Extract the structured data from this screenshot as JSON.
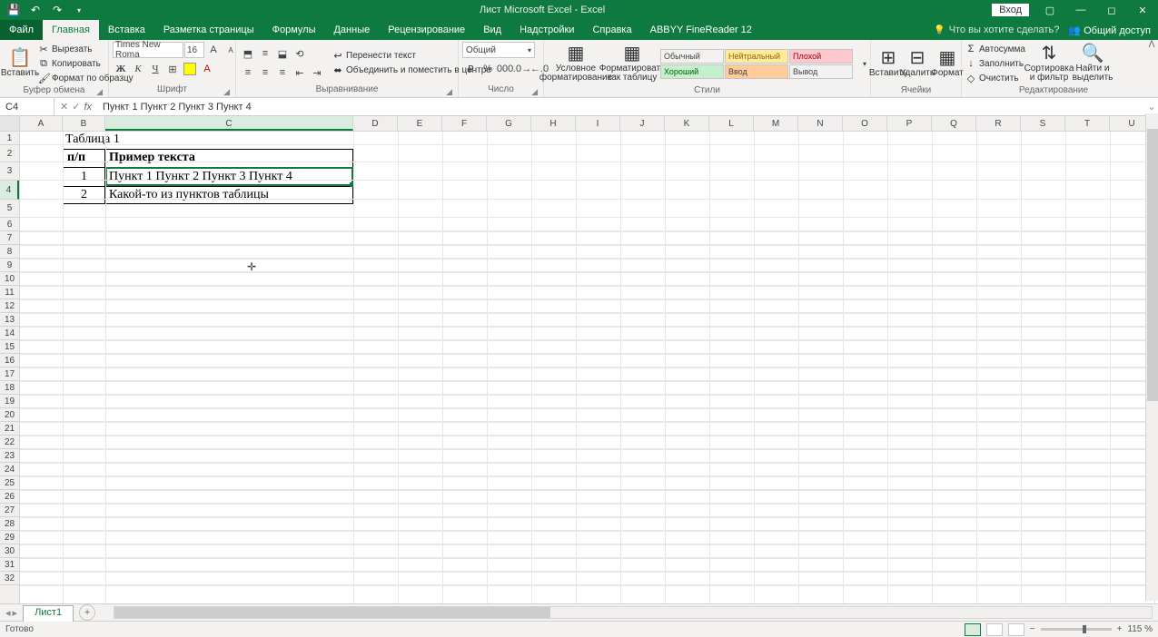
{
  "titlebar": {
    "title": "Лист Microsoft Excel - Excel",
    "login": "Вход"
  },
  "tabs": {
    "file": "Файл",
    "home": "Главная",
    "insert": "Вставка",
    "layout": "Разметка страницы",
    "formulas": "Формулы",
    "data": "Данные",
    "review": "Рецензирование",
    "view": "Вид",
    "addins": "Надстройки",
    "help": "Справка",
    "abbyy": "ABBYY FineReader 12",
    "tellme": "Что вы хотите сделать?",
    "share": "Общий доступ"
  },
  "ribbon": {
    "clipboard": {
      "paste": "Вставить",
      "cut": "Вырезать",
      "copy": "Копировать",
      "painter": "Формат по образцу",
      "label": "Буфер обмена"
    },
    "font": {
      "name": "Times New Roma",
      "size": "16",
      "label": "Шрифт"
    },
    "align": {
      "wrap": "Перенести текст",
      "merge": "Объединить и поместить в центре",
      "label": "Выравнивание"
    },
    "number": {
      "format": "Общий",
      "label": "Число"
    },
    "styles": {
      "cond": "Условное",
      "cond2": "форматирование",
      "table": "Форматировать",
      "table2": "как таблицу",
      "s1": "Обычный",
      "s2": "Нейтральный",
      "s3": "Плохой",
      "s4": "Хороший",
      "s5": "Ввод",
      "s6": "Вывод",
      "label": "Стили"
    },
    "cells": {
      "insert": "Вставить",
      "delete": "Удалить",
      "format": "Формат",
      "label": "Ячейки"
    },
    "editing": {
      "sum": "Автосумма",
      "fill": "Заполнить",
      "clear": "Очистить",
      "sort": "Сортировка",
      "sort2": "и фильтр",
      "find": "Найти и",
      "find2": "выделить",
      "label": "Редактирование"
    }
  },
  "namebox": "C4",
  "formula": "Пункт 1 Пункт 2 Пункт 3 Пункт 4",
  "columns": [
    "A",
    "B",
    "C",
    "D",
    "E",
    "F",
    "G",
    "H",
    "I",
    "J",
    "K",
    "L",
    "M",
    "N",
    "O",
    "P",
    "Q",
    "R",
    "S",
    "T",
    "U"
  ],
  "rows": [
    "1",
    "2",
    "3",
    "4",
    "5",
    "6",
    "7",
    "8",
    "9",
    "10",
    "11",
    "12",
    "13",
    "14",
    "15",
    "16",
    "17",
    "18",
    "19",
    "20",
    "21",
    "22",
    "23",
    "24",
    "25",
    "26",
    "27",
    "28",
    "29",
    "30",
    "31",
    "32"
  ],
  "cells": {
    "b2": "Таблица 1",
    "b3": "п/п",
    "c3": "Пример текста",
    "b4": "1",
    "c4": "Пункт 1 Пункт 2 Пункт 3 Пункт 4",
    "b5": "2",
    "c5": "Какой-то из пунктов таблицы"
  },
  "sheet": {
    "tab": "Лист1"
  },
  "status": {
    "ready": "Готово",
    "zoom": "115 %"
  }
}
